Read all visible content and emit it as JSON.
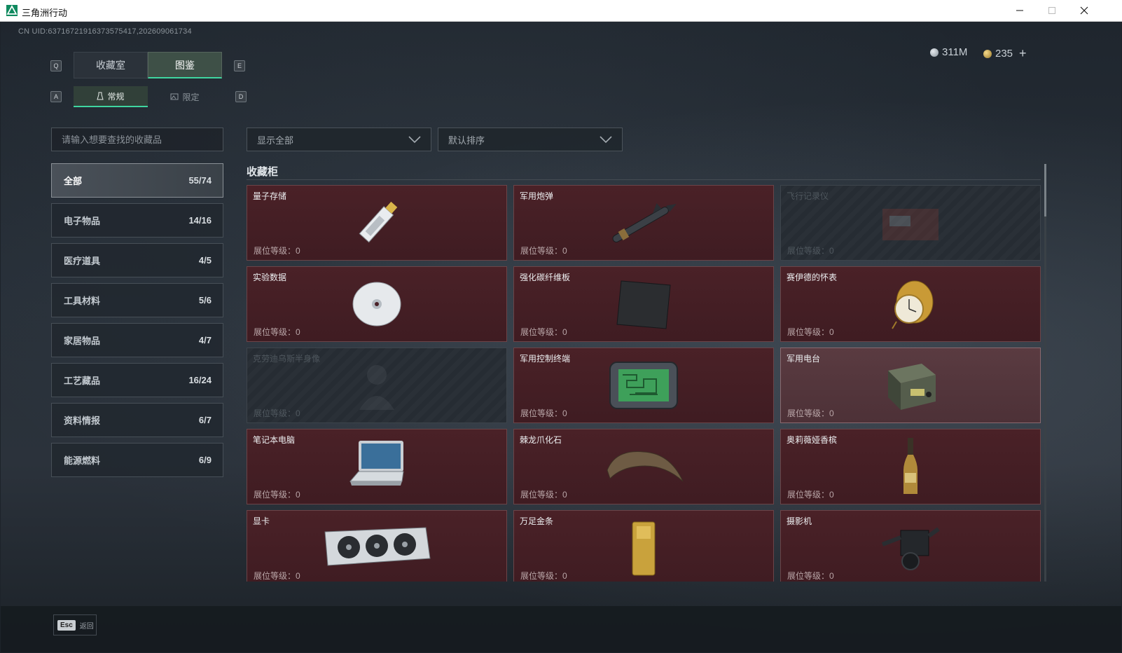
{
  "window": {
    "title": "三角洲行动"
  },
  "uid": "CN UID:6371672191637357541​7,202609061734",
  "currency": {
    "silver": "311M",
    "gold": "235",
    "add": "+"
  },
  "keys": {
    "prev_tab": "Q",
    "next_tab": "E",
    "prev_sub": "A",
    "next_sub": "D"
  },
  "tabs": [
    {
      "label": "收藏室",
      "active": false
    },
    {
      "label": "图鉴",
      "active": true
    }
  ],
  "subtabs": [
    {
      "label": "常规",
      "active": true
    },
    {
      "label": "限定",
      "active": false
    }
  ],
  "search": {
    "placeholder": "请输入想要查找的收藏品"
  },
  "filters": {
    "show": "显示全部",
    "sort": "默认排序"
  },
  "categories": [
    {
      "label": "全部",
      "count": "55/74",
      "active": true
    },
    {
      "label": "电子物品",
      "count": "14/16"
    },
    {
      "label": "医疗道具",
      "count": "4/5"
    },
    {
      "label": "工具材料",
      "count": "5/6"
    },
    {
      "label": "家居物品",
      "count": "4/7"
    },
    {
      "label": "工艺藏品",
      "count": "16/24"
    },
    {
      "label": "资料情报",
      "count": "6/7"
    },
    {
      "label": "能源燃料",
      "count": "6/9"
    }
  ],
  "section_title": "收藏柜",
  "items": [
    {
      "name": "量子存储",
      "level": "展位等级：0",
      "icon": "usb-drive-icon",
      "state": "normal"
    },
    {
      "name": "军用炮弹",
      "level": "展位等级：0",
      "icon": "missile-icon",
      "state": "normal"
    },
    {
      "name": "飞行记录仪",
      "level": "展位等级：0",
      "icon": "flight-recorder-icon",
      "state": "locked"
    },
    {
      "name": "实验数据",
      "level": "展位等级：0",
      "icon": "disc-icon",
      "state": "normal"
    },
    {
      "name": "强化碳纤维板",
      "level": "展位等级：0",
      "icon": "carbon-plate-icon",
      "state": "normal"
    },
    {
      "name": "赛伊德的怀表",
      "level": "展位等级：0",
      "icon": "pocket-watch-icon",
      "state": "normal"
    },
    {
      "name": "克劳迪乌斯半身像",
      "level": "展位等级：0",
      "icon": "bust-icon",
      "state": "locked"
    },
    {
      "name": "军用控制终端",
      "level": "展位等级：0",
      "icon": "terminal-icon",
      "state": "normal"
    },
    {
      "name": "军用电台",
      "level": "展位等级：0",
      "icon": "radio-icon",
      "state": "highlight"
    },
    {
      "name": "笔记本电脑",
      "level": "展位等级：0",
      "icon": "laptop-icon",
      "state": "normal"
    },
    {
      "name": "棘龙爪化石",
      "level": "展位等级：0",
      "icon": "claw-fossil-icon",
      "state": "normal"
    },
    {
      "name": "奥莉薇娅香槟",
      "level": "展位等级：0",
      "icon": "champagne-icon",
      "state": "normal"
    },
    {
      "name": "显卡",
      "level": "展位等级：0",
      "icon": "gpu-icon",
      "state": "normal"
    },
    {
      "name": "万足金条",
      "level": "展位等级：0",
      "icon": "gold-bar-icon",
      "state": "normal"
    },
    {
      "name": "摄影机",
      "level": "展位等级：0",
      "icon": "camera-icon",
      "state": "normal"
    }
  ],
  "footer": {
    "esc_key": "Esc",
    "back_label": "返回"
  },
  "colors": {
    "accent": "#3fd6a0",
    "card_bg": "#4a2127",
    "card_border": "#6b4448"
  }
}
